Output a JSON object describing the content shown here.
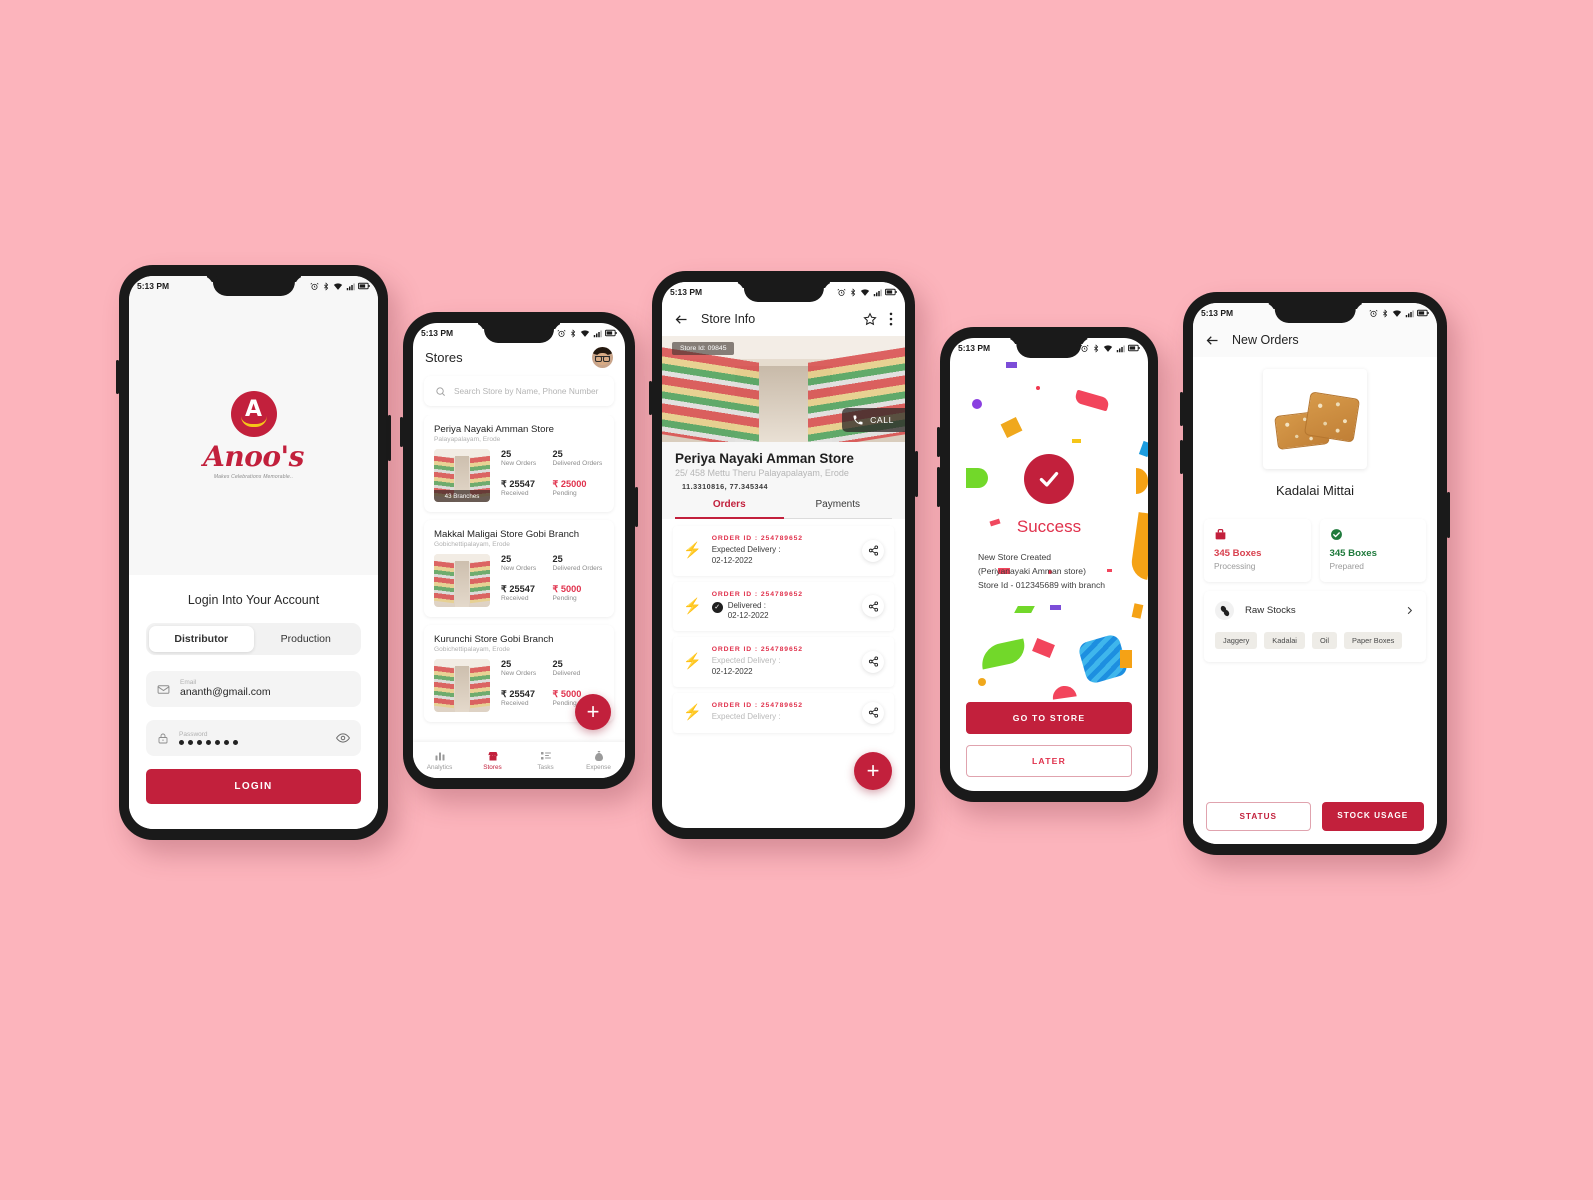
{
  "background_color": "#fcb4bc",
  "brand_color": "#c2203c",
  "status_bar": {
    "time": "5:13 PM",
    "icons": [
      "alarm-icon",
      "bluetooth-icon",
      "wifi-icon",
      "signal-icon",
      "battery-icon"
    ]
  },
  "phone_login": {
    "logo": {
      "mark_letter": "A",
      "wordmark": "Anoo",
      "wordmark_apostrophe": "'s",
      "tagline": "Makes Celebrations Memorable.."
    },
    "title": "Login Into Your Account",
    "segments": [
      {
        "label": "Distributor",
        "selected": true
      },
      {
        "label": "Production",
        "selected": false
      }
    ],
    "email_field": {
      "label": "Email",
      "value": "ananth@gmail.com",
      "icon": "mail-icon"
    },
    "password_field": {
      "label": "Password",
      "value": "●●●●●●●",
      "icon": "lock-icon",
      "reveal_icon": "eye-icon"
    },
    "login_button": "LOGIN"
  },
  "phone_stores": {
    "title": "Stores",
    "avatar": "user-avatar",
    "search_placeholder": "Search Store by Name, Phone Number",
    "stores": [
      {
        "name": "Periya Nayaki Amman Store",
        "location": "Palayapalayam, Erode",
        "branches_badge": "43 Branches",
        "new_orders_value": "25",
        "new_orders_label": "New Orders",
        "delivered_value": "25",
        "delivered_label": "Delivered Orders",
        "received_value": "₹ 25547",
        "received_label": "Received",
        "pending_value": "₹ 25000",
        "pending_label": "Pending"
      },
      {
        "name": "Makkal Maligai Store Gobi Branch",
        "location": "Gobichettipalayam, Erode",
        "branches_badge": "",
        "new_orders_value": "25",
        "new_orders_label": "New Orders",
        "delivered_value": "25",
        "delivered_label": "Delivered Orders",
        "received_value": "₹ 25547",
        "received_label": "Received",
        "pending_value": "₹ 5000",
        "pending_label": "Pending"
      },
      {
        "name": "Kurunchi Store Gobi Branch",
        "location": "Gobichettipalayam, Erode",
        "branches_badge": "",
        "new_orders_value": "25",
        "new_orders_label": "New Orders",
        "delivered_value": "25",
        "delivered_label": "Delivered",
        "received_value": "₹ 25547",
        "received_label": "Received",
        "pending_value": "₹ 5000",
        "pending_label": "Pending"
      }
    ],
    "fab": "+",
    "tabs": [
      {
        "label": "Analytics",
        "icon": "bar-chart-icon",
        "active": false
      },
      {
        "label": "Stores",
        "icon": "store-icon",
        "active": true
      },
      {
        "label": "Tasks",
        "icon": "list-icon",
        "active": false
      },
      {
        "label": "Expense",
        "icon": "money-bag-icon",
        "active": false
      }
    ]
  },
  "phone_store_info": {
    "appbar": {
      "back_icon": "back-arrow-icon",
      "title": "Store Info",
      "star_icon": "star-outline-icon",
      "more_icon": "more-vertical-icon"
    },
    "hero": {
      "store_id_badge": "Store Id: 09845",
      "call_label": "CALL",
      "call_icon": "phone-icon"
    },
    "store_name": "Periya Nayaki Amman Store",
    "store_address": "25/ 458 Mettu Theru Palayapalayam, Erode",
    "store_geo": "11.3310816, 77.345344",
    "tabs": [
      {
        "label": "Orders",
        "active": true
      },
      {
        "label": "Payments",
        "active": false
      }
    ],
    "orders": [
      {
        "id": "ORDER ID : 254789652",
        "status_label": "Expected Delivery :",
        "date": "02-12-2022",
        "delivered": false,
        "dim": false
      },
      {
        "id": "ORDER ID : 254789652",
        "status_label": "Delivered :",
        "date": "02-12-2022",
        "delivered": true,
        "dim": false
      },
      {
        "id": "ORDER ID : 254789652",
        "status_label": "Expected Delivery :",
        "date": "02-12-2022",
        "delivered": false,
        "dim": true
      },
      {
        "id": "ORDER ID : 254789652",
        "status_label": "Expected Delivery :",
        "date": "",
        "delivered": false,
        "dim": true
      }
    ],
    "fab": "+"
  },
  "phone_success": {
    "check_icon": "check-circle-icon",
    "title": "Success",
    "message_lines": [
      "New Store Created",
      "(Periyanayaki Amman store)",
      "Store Id - 012345689 with branch"
    ],
    "primary_button": "GO TO STORE",
    "secondary_button": "LATER"
  },
  "phone_new_orders": {
    "appbar": {
      "back_icon": "back-arrow-icon",
      "title": "New Orders"
    },
    "product_name": "Kadalai Mittai",
    "product_image": "kadalai-mittai-photo",
    "stats": [
      {
        "value": "345 Boxes",
        "label": "Processing",
        "icon": "box-icon",
        "color": "#d8414f"
      },
      {
        "value": "345 Boxes",
        "label": "Prepared",
        "icon": "check-badge-icon",
        "color": "#1f7a3c"
      }
    ],
    "raw_stocks": {
      "title": "Raw Stocks",
      "icon": "peanut-icon",
      "chevron": "chevron-right-icon",
      "chips": [
        "Jaggery",
        "Kadalai",
        "Oil",
        "Paper Boxes"
      ]
    },
    "footer_buttons": [
      {
        "label": "STATUS",
        "style": "outline"
      },
      {
        "label": "STOCK USAGE",
        "style": "solid"
      }
    ]
  }
}
